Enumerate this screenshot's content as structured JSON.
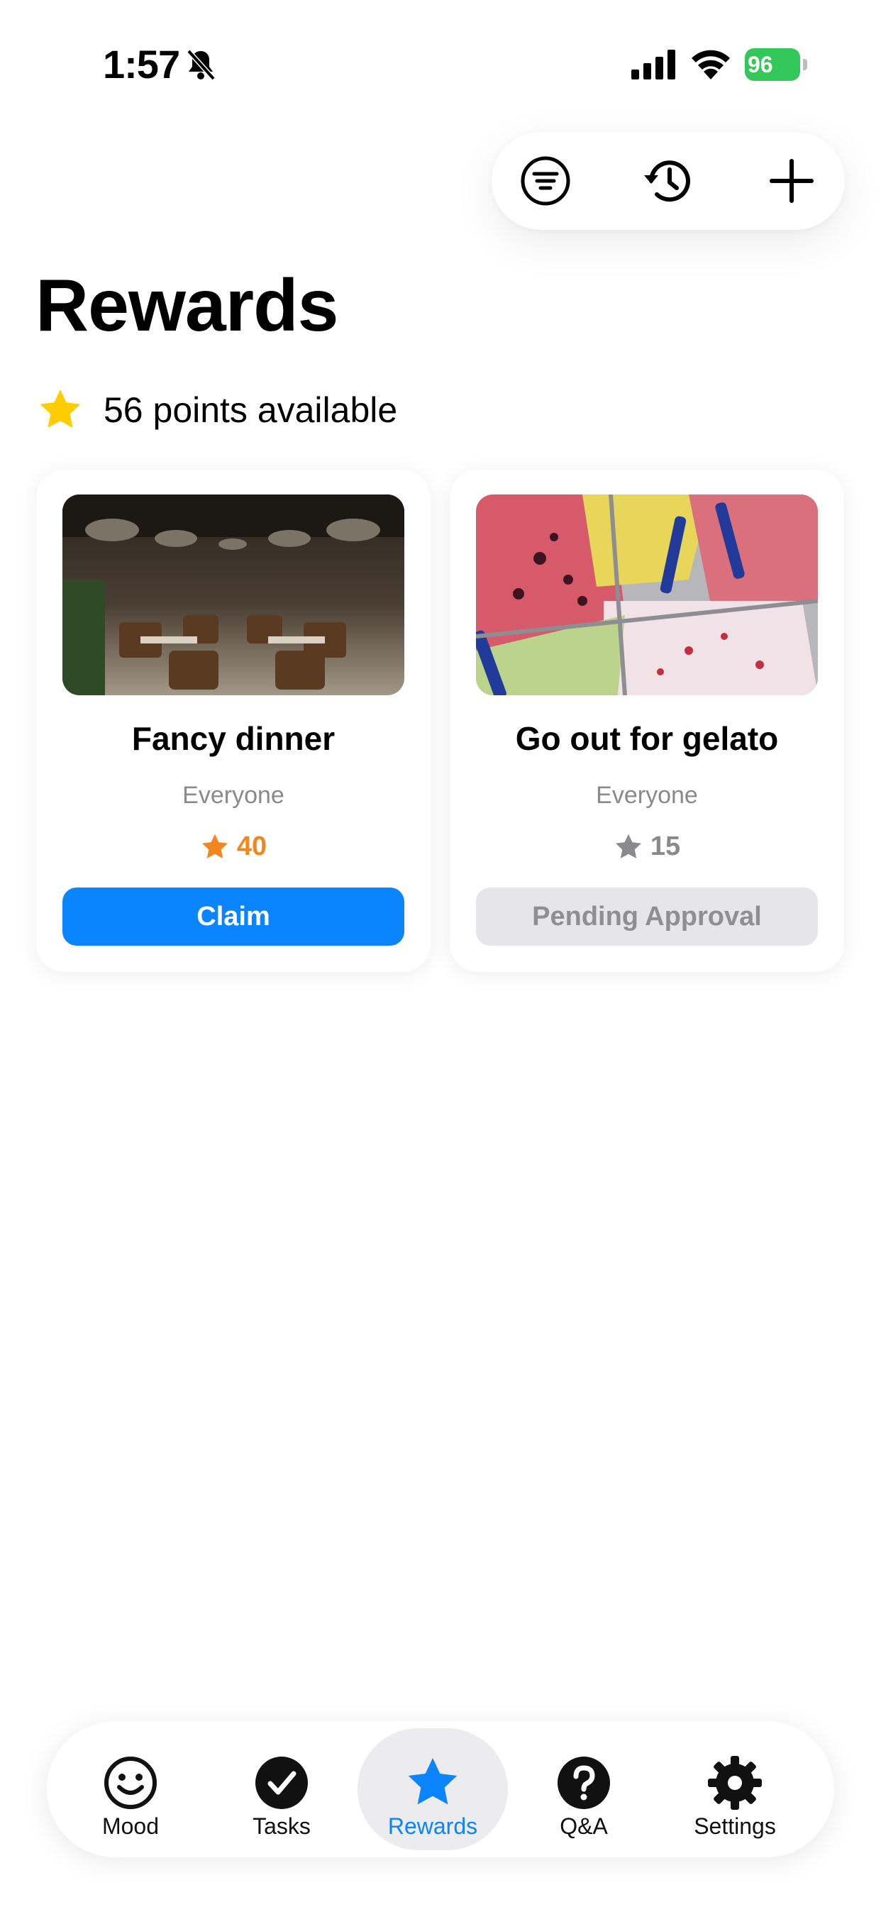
{
  "status_bar": {
    "time": "1:57",
    "battery": "96"
  },
  "toolbar": {
    "icons": [
      "filter-icon",
      "history-icon",
      "plus-icon"
    ]
  },
  "header": {
    "title": "Rewards",
    "points_text": "56 points available"
  },
  "rewards": [
    {
      "title": "Fancy dinner",
      "assignee": "Everyone",
      "points": "40",
      "button": "Claim",
      "state": "claimable"
    },
    {
      "title": "Go out for gelato",
      "assignee": "Everyone",
      "points": "15",
      "button": "Pending Approval",
      "state": "pending"
    }
  ],
  "tabs": [
    {
      "label": "Mood",
      "icon": "smiley-icon"
    },
    {
      "label": "Tasks",
      "icon": "checkmark-circle-icon"
    },
    {
      "label": "Rewards",
      "icon": "star-icon",
      "active": true
    },
    {
      "label": "Q&A",
      "icon": "question-circle-icon"
    },
    {
      "label": "Settings",
      "icon": "gear-icon"
    }
  ],
  "colors": {
    "accent": "#0a84ff",
    "star": "#ffcc00",
    "cost_orange": "#f0881f",
    "battery": "#34c759",
    "disabled_bg": "#e5e5ea"
  }
}
